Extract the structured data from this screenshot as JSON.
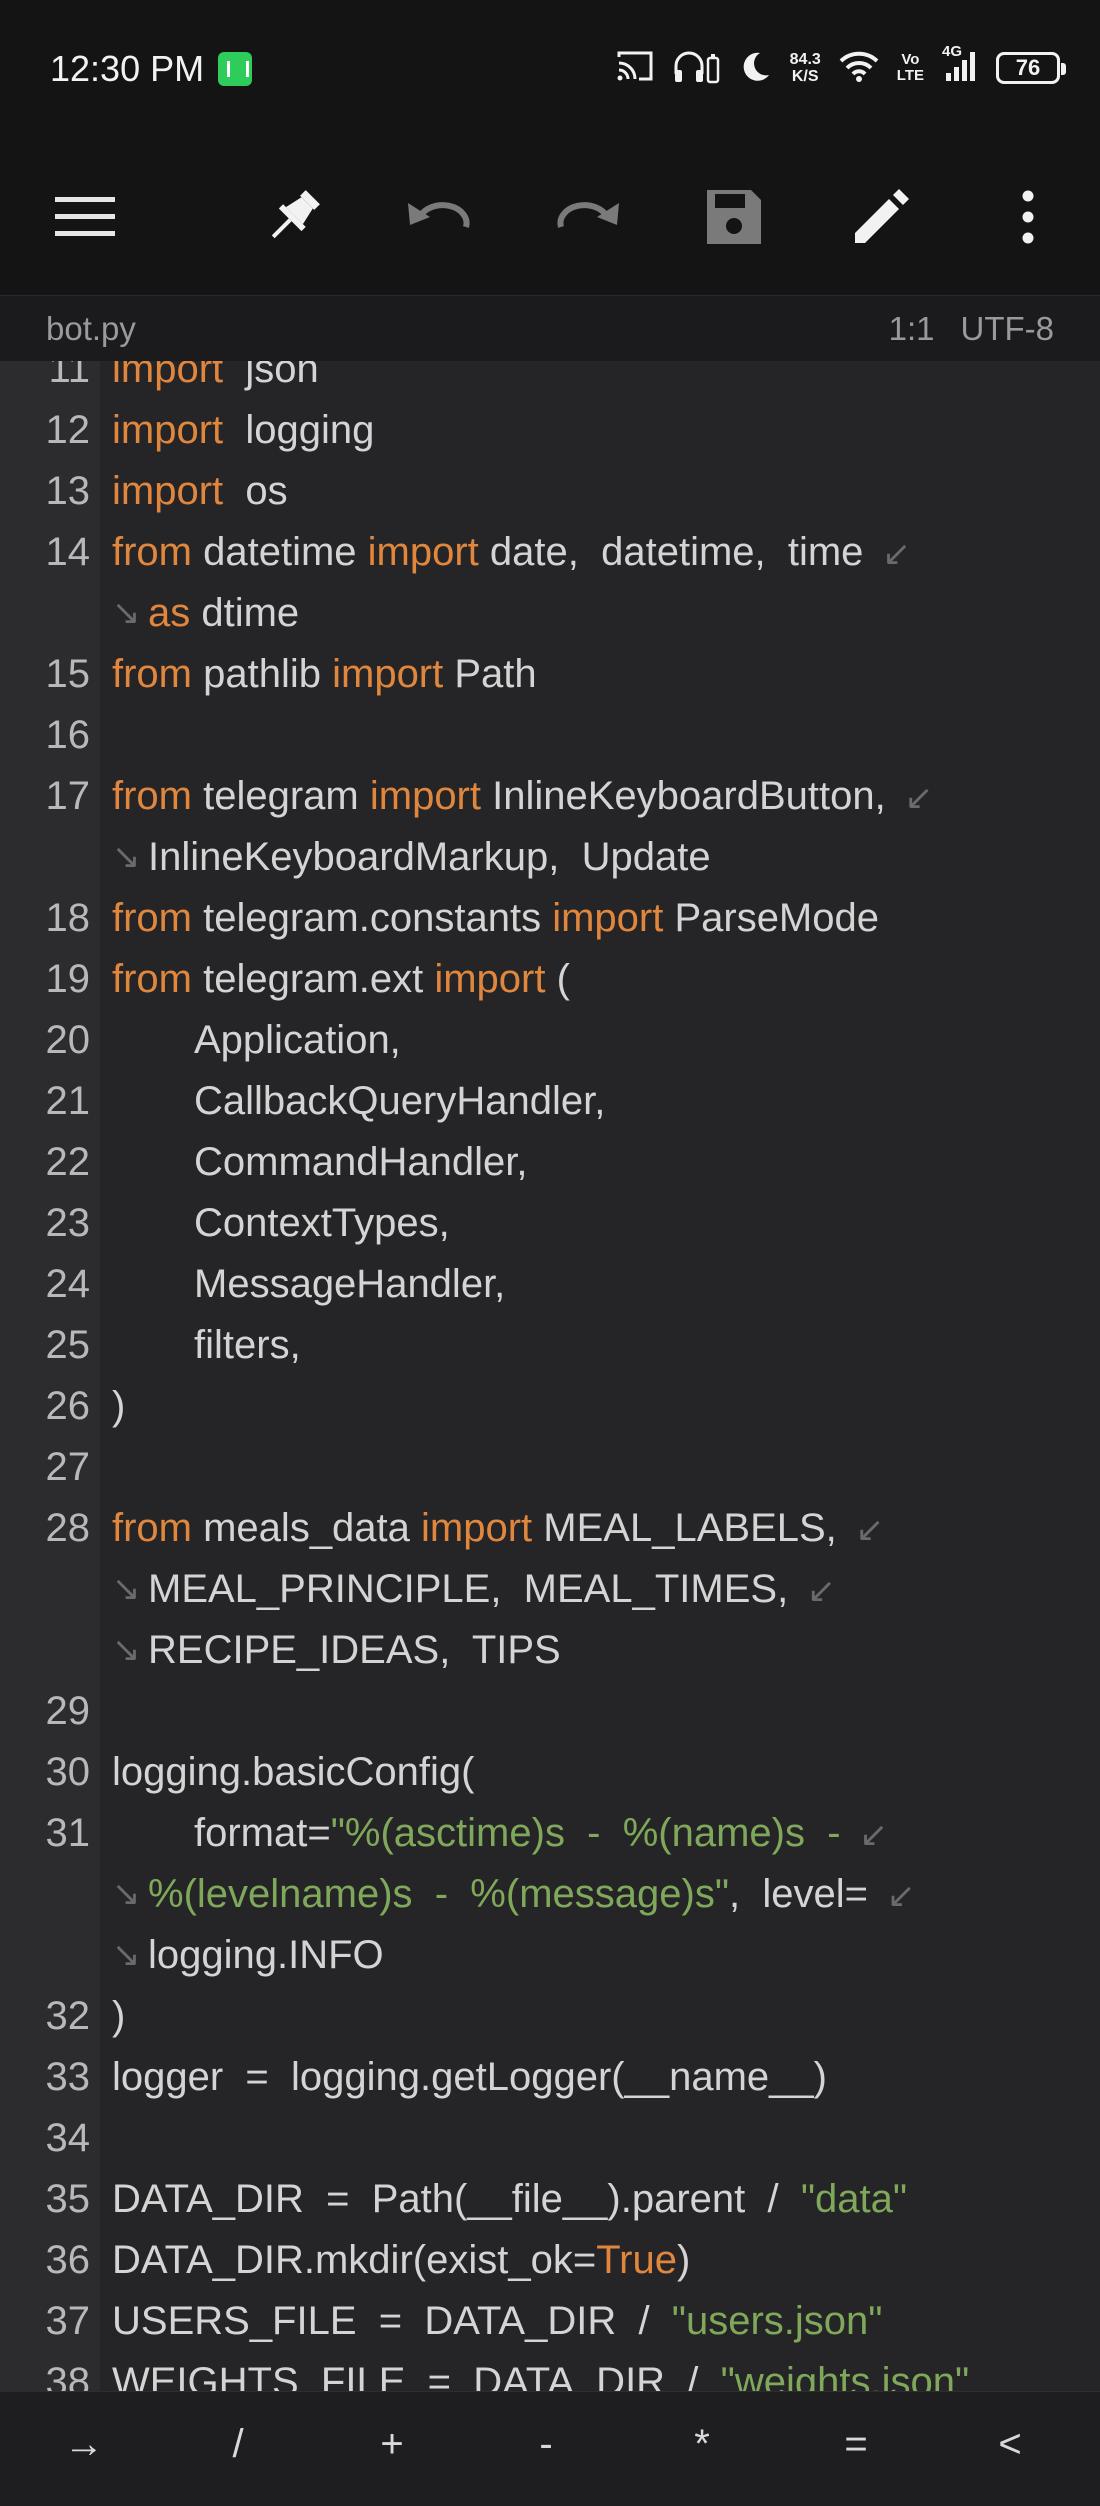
{
  "status_bar": {
    "time": "12:30 PM",
    "net_speed_value": "84.3",
    "net_speed_unit": "K/S",
    "volte_top": "Vo",
    "volte_bottom": "LTE",
    "network": "4G",
    "battery": "76"
  },
  "toolbar": {
    "icons": [
      "menu-icon",
      "pin-icon",
      "undo-icon",
      "redo-icon",
      "save-icon",
      "edit-icon",
      "more-vert-icon"
    ]
  },
  "file_bar": {
    "filename": "bot.py",
    "cursor_position": "1:1",
    "encoding": "UTF-8"
  },
  "editor": {
    "lines": [
      {
        "n": "11",
        "parts": [
          [
            "kw",
            "import"
          ],
          [
            "",
            "  json"
          ]
        ]
      },
      {
        "n": "12",
        "parts": [
          [
            "kw",
            "import"
          ],
          [
            "",
            "  logging"
          ]
        ]
      },
      {
        "n": "13",
        "parts": [
          [
            "kw",
            "import"
          ],
          [
            "",
            "  os"
          ]
        ]
      },
      {
        "n": "14",
        "parts": [
          [
            "kw",
            "from"
          ],
          [
            "",
            " datetime "
          ],
          [
            "kw",
            "import"
          ],
          [
            "",
            " date,  datetime,  time"
          ]
        ],
        "wrap_end": true
      },
      {
        "n": "",
        "wrap_start": true,
        "parts": [
          [
            "kw",
            "as"
          ],
          [
            "",
            " dtime"
          ]
        ]
      },
      {
        "n": "15",
        "parts": [
          [
            "kw",
            "from"
          ],
          [
            "",
            " pathlib "
          ],
          [
            "kw",
            "import"
          ],
          [
            "",
            " Path"
          ]
        ]
      },
      {
        "n": "16",
        "parts": []
      },
      {
        "n": "17",
        "parts": [
          [
            "kw",
            "from"
          ],
          [
            "",
            " telegram "
          ],
          [
            "kw",
            "import"
          ],
          [
            "",
            " InlineKeyboardButton,"
          ]
        ],
        "wrap_end": true
      },
      {
        "n": "",
        "wrap_start": true,
        "parts": [
          [
            "",
            "InlineKeyboardMarkup,  Update"
          ]
        ]
      },
      {
        "n": "18",
        "parts": [
          [
            "kw",
            "from"
          ],
          [
            "",
            " telegram.constants "
          ],
          [
            "kw",
            "import"
          ],
          [
            "",
            " ParseMode"
          ]
        ]
      },
      {
        "n": "19",
        "parts": [
          [
            "kw",
            "from"
          ],
          [
            "",
            " telegram.ext "
          ],
          [
            "kw",
            "import"
          ],
          [
            "",
            " ("
          ]
        ]
      },
      {
        "n": "20",
        "indent": true,
        "parts": [
          [
            "",
            "Application,"
          ]
        ]
      },
      {
        "n": "21",
        "indent": true,
        "parts": [
          [
            "",
            "CallbackQueryHandler,"
          ]
        ]
      },
      {
        "n": "22",
        "indent": true,
        "parts": [
          [
            "",
            "CommandHandler,"
          ]
        ]
      },
      {
        "n": "23",
        "indent": true,
        "parts": [
          [
            "",
            "ContextTypes,"
          ]
        ]
      },
      {
        "n": "24",
        "indent": true,
        "parts": [
          [
            "",
            "MessageHandler,"
          ]
        ]
      },
      {
        "n": "25",
        "indent": true,
        "parts": [
          [
            "",
            "filters,"
          ]
        ]
      },
      {
        "n": "26",
        "parts": [
          [
            "",
            ")"
          ]
        ]
      },
      {
        "n": "27",
        "parts": []
      },
      {
        "n": "28",
        "parts": [
          [
            "kw",
            "from"
          ],
          [
            "",
            " meals_data "
          ],
          [
            "kw",
            "import"
          ],
          [
            "",
            " MEAL_LABELS,"
          ]
        ],
        "wrap_end": true
      },
      {
        "n": "",
        "wrap_start": true,
        "parts": [
          [
            "",
            "MEAL_PRINCIPLE,  MEAL_TIMES,"
          ]
        ],
        "wrap_end": true
      },
      {
        "n": "",
        "wrap_start": true,
        "parts": [
          [
            "",
            "RECIPE_IDEAS,  TIPS"
          ]
        ]
      },
      {
        "n": "29",
        "parts": []
      },
      {
        "n": "30",
        "parts": [
          [
            "",
            "logging.basicConfig("
          ]
        ]
      },
      {
        "n": "31",
        "indent": true,
        "parts": [
          [
            "",
            "format="
          ],
          [
            "str",
            "\"%(asctime)s  -  %(name)s  -"
          ]
        ],
        "wrap_end": true
      },
      {
        "n": "",
        "wrap_start": true,
        "parts": [
          [
            "str",
            "%(levelname)s  -  %(message)s\""
          ],
          [
            "",
            ",  level="
          ]
        ],
        "wrap_end": true
      },
      {
        "n": "",
        "wrap_start": true,
        "parts": [
          [
            "",
            "logging.INFO"
          ]
        ]
      },
      {
        "n": "32",
        "parts": [
          [
            "",
            ")"
          ]
        ]
      },
      {
        "n": "33",
        "parts": [
          [
            "",
            "logger  =  logging.getLogger(__name__)"
          ]
        ]
      },
      {
        "n": "34",
        "parts": []
      },
      {
        "n": "35",
        "parts": [
          [
            "",
            "DATA_DIR  =  Path(__file__).parent  /  "
          ],
          [
            "str",
            "\"data\""
          ]
        ]
      },
      {
        "n": "36",
        "parts": [
          [
            "",
            "DATA_DIR.mkdir(exist_ok="
          ],
          [
            "kw",
            "True"
          ],
          [
            "",
            ")"
          ]
        ]
      },
      {
        "n": "37",
        "parts": [
          [
            "",
            "USERS_FILE  =  DATA_DIR  /  "
          ],
          [
            "str",
            "\"users.json\""
          ]
        ]
      },
      {
        "n": "38",
        "parts": [
          [
            "",
            "WEIGHTS_FILE  =  DATA_DIR  /  "
          ],
          [
            "str",
            "\"weights.json\""
          ]
        ]
      }
    ]
  },
  "bottom_bar": {
    "keys": [
      "→",
      "/",
      "+",
      "-",
      "*",
      "=",
      "<"
    ]
  }
}
